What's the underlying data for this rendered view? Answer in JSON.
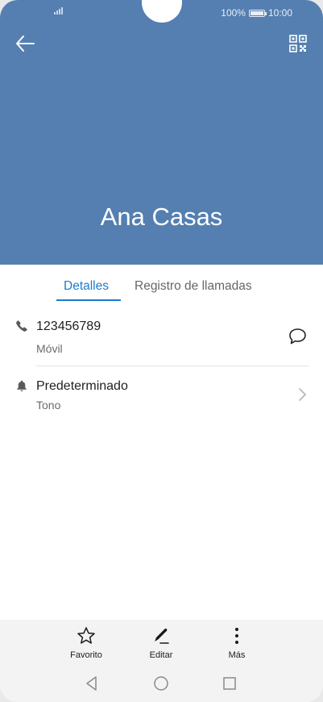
{
  "status_bar": {
    "battery": "100%",
    "time": "10:00"
  },
  "header": {
    "contact_name": "Ana Casas",
    "accent_color": "#547fb0"
  },
  "tabs": [
    {
      "label": "Detalles",
      "active": true
    },
    {
      "label": "Registro de llamadas",
      "active": false
    }
  ],
  "details": {
    "phone": {
      "number": "123456789",
      "type": "Móvil"
    },
    "ringtone": {
      "value": "Predeterminado",
      "label": "Tono"
    }
  },
  "actions": [
    {
      "label": "Favorito",
      "icon": "star-icon"
    },
    {
      "label": "Editar",
      "icon": "pencil-icon"
    },
    {
      "label": "Más",
      "icon": "more-vertical-icon"
    }
  ],
  "icons": {
    "back": "arrow-left-icon",
    "qr": "qr-code-icon",
    "phone": "phone-icon",
    "message": "message-bubble-icon",
    "bell": "bell-icon",
    "chevron": "chevron-right-icon"
  },
  "colors": {
    "accent_blue": "#1b7ccf",
    "header_blue": "#547fb0"
  }
}
